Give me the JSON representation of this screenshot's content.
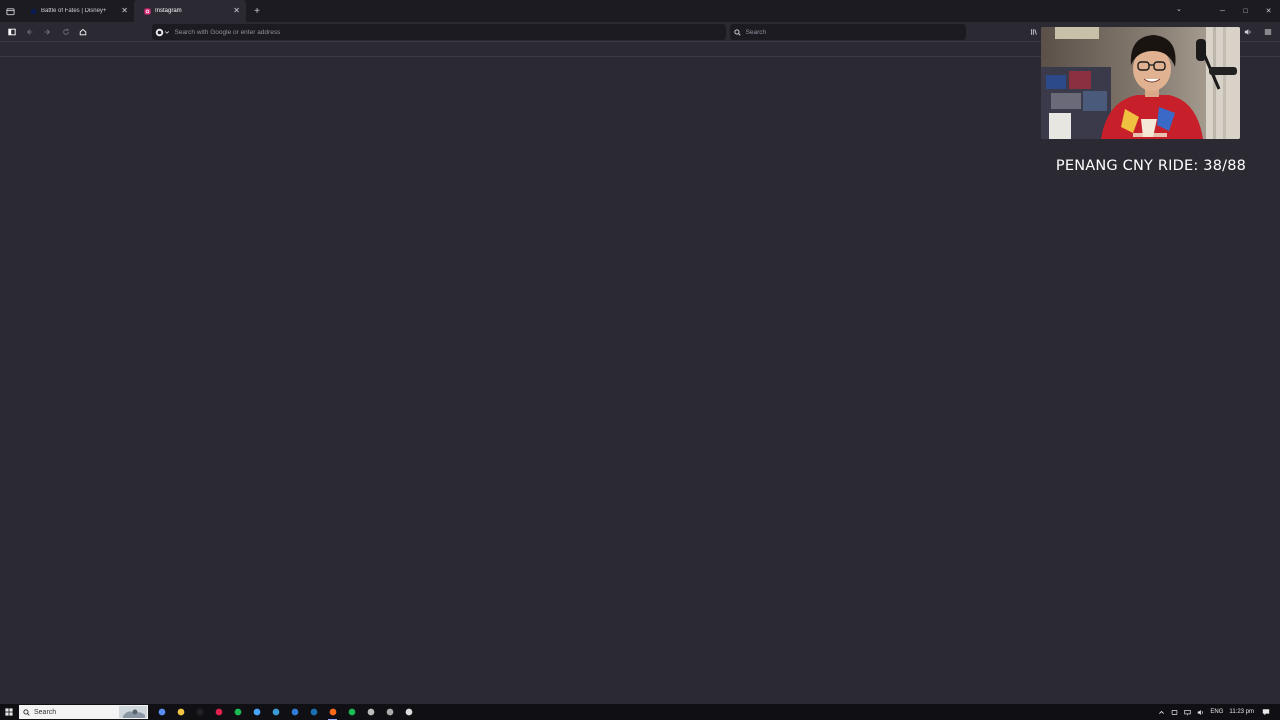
{
  "browser": {
    "tabs": [
      {
        "title": "Battle of Fates | Disney+",
        "close_label": "✕",
        "active": false
      },
      {
        "title": "Instagram",
        "close_label": "✕",
        "active": true
      }
    ],
    "new_tab_label": "+",
    "overflow_label": "⌄",
    "window_controls": {
      "minimize": "─",
      "maximize": "□",
      "close": "✕"
    }
  },
  "navbar": {
    "url_placeholder": "Search with Google or enter address",
    "search_placeholder": "Search"
  },
  "overlay": {
    "caption": "PENANG CNY RIDE: 38/88"
  },
  "taskbar": {
    "search_label": "Search",
    "apps": [
      {
        "icon": "settings-app-icon",
        "color": "#5a8dee"
      },
      {
        "icon": "file-explorer-icon",
        "color": "#f4c542"
      },
      {
        "icon": "epic-games-icon",
        "color": "#222222"
      },
      {
        "icon": "red-app-icon",
        "color": "#e02050"
      },
      {
        "icon": "spotify-green-icon",
        "color": "#1db954"
      },
      {
        "icon": "c-app-icon",
        "color": "#4aa3ff"
      },
      {
        "icon": "check-app-icon",
        "color": "#3c9bd6"
      },
      {
        "icon": "mail-icon",
        "color": "#2f7bd6"
      },
      {
        "icon": "steam-icon",
        "color": "#1b6fb0"
      },
      {
        "icon": "firefox-icon",
        "color": "#ff6a1a"
      },
      {
        "icon": "spotify-icon",
        "color": "#1db954"
      },
      {
        "icon": "arrow-app-icon",
        "color": "#bbbbbb"
      },
      {
        "icon": "keyboard-app-icon",
        "color": "#aaaaaa"
      },
      {
        "icon": "obs-icon",
        "color": "#dddddd"
      }
    ],
    "tray": {
      "language": "ENG",
      "time": "11:23 pm"
    }
  },
  "colors": {
    "content_bg": "#2b2a33",
    "tabstrip_bg": "#1c1b22",
    "taskbar_bg": "#101014"
  }
}
